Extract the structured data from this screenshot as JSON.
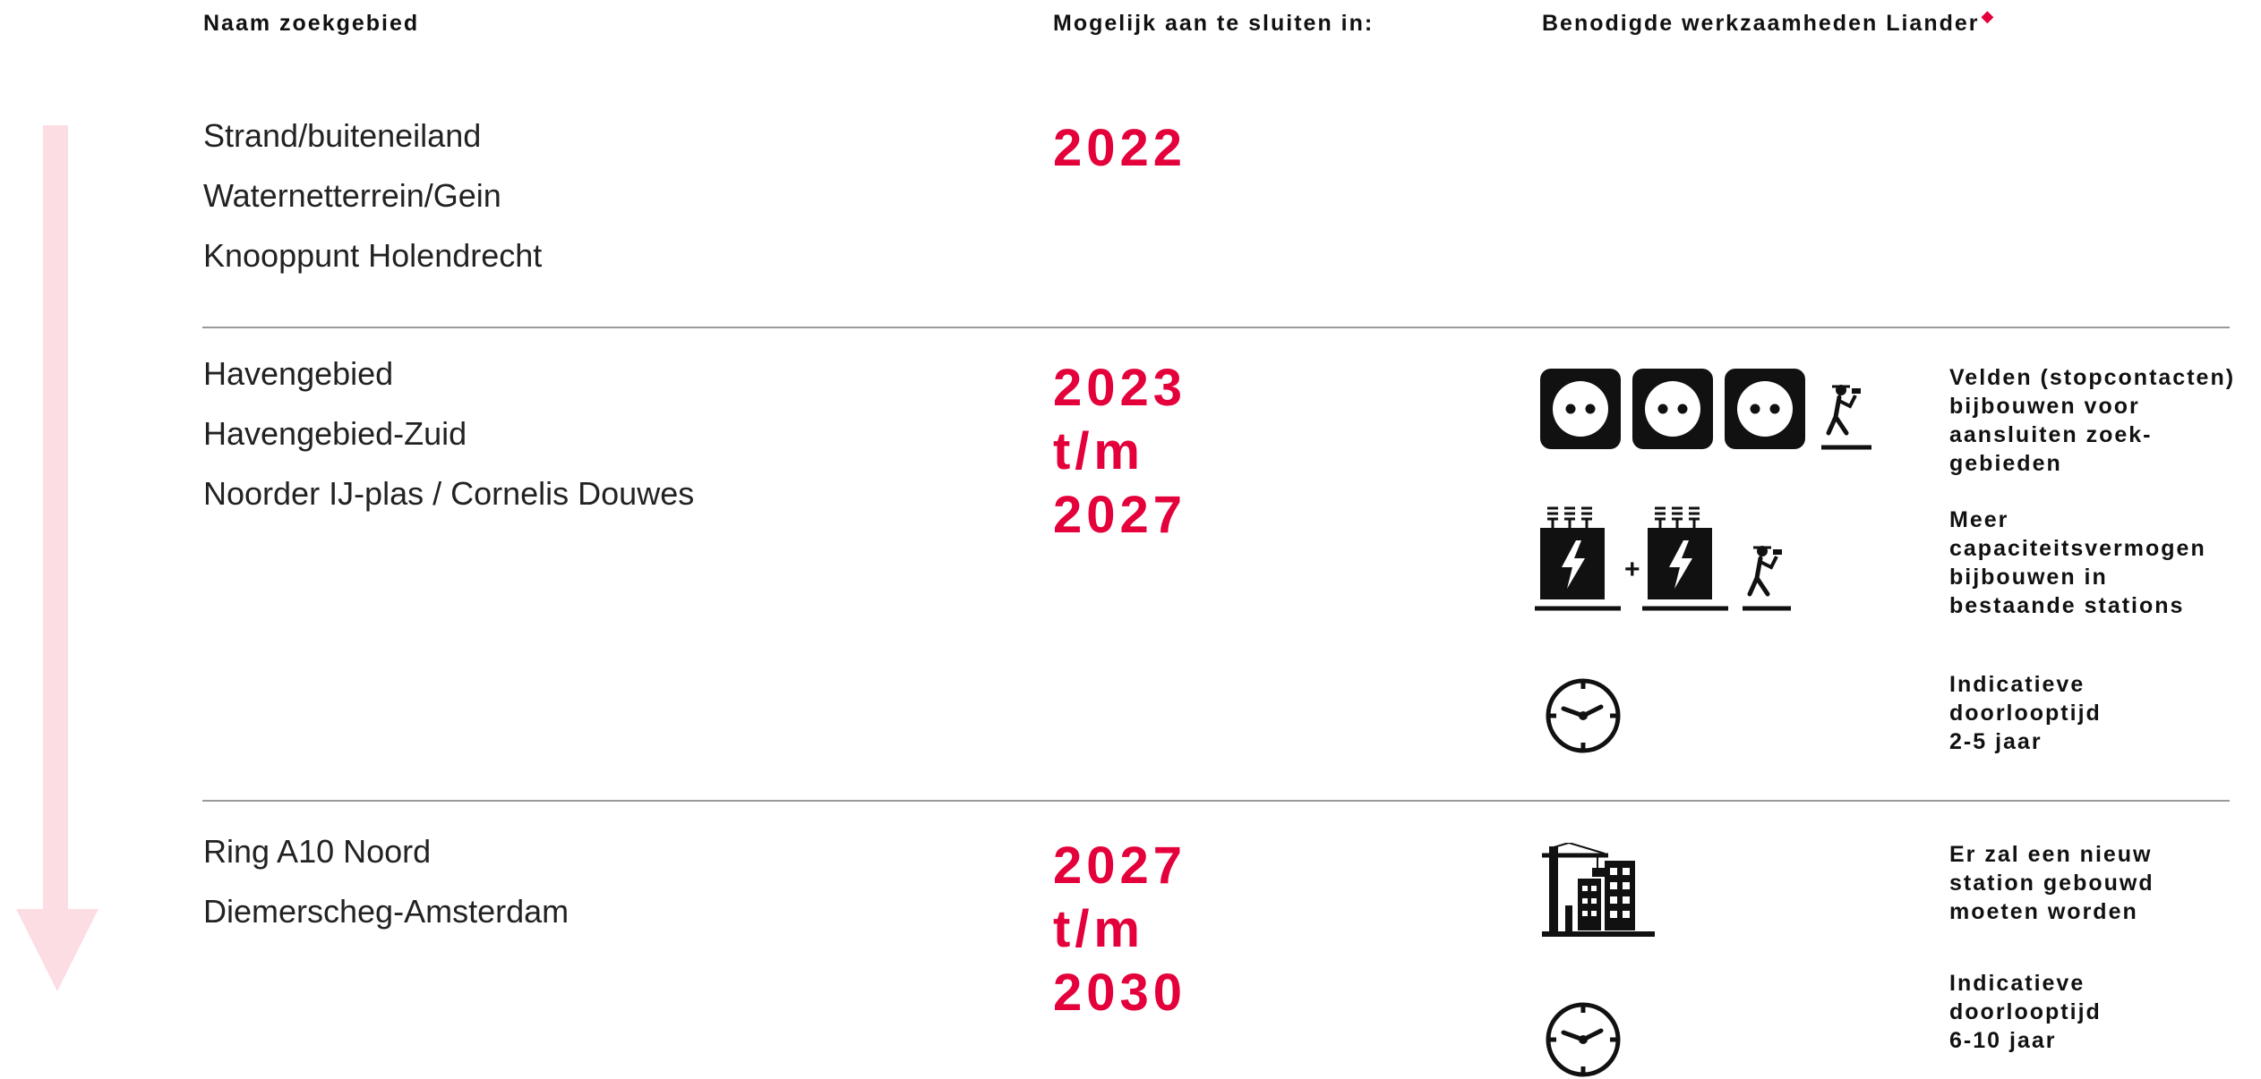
{
  "header": {
    "col_name": "Naam zoekgebied",
    "col_year": "Mogelijk aan te sluiten in:",
    "col_work": "Benodigde werkzaamheden Liander",
    "diamond": "◆"
  },
  "colors": {
    "accent": "#e4003a",
    "arrow": "#fddde4",
    "rule": "#9a9a9a",
    "icon": "#111111"
  },
  "groups": [
    {
      "names": [
        "Strand/buiteneiland",
        "Waternetterrein/Gein",
        "Knooppunt Holendrecht"
      ],
      "year": [
        "2022"
      ]
    },
    {
      "names": [
        "Havengebied",
        "Havengebied-Zuid",
        "Noorder IJ-plas / Cornelis Douwes"
      ],
      "year": [
        "2023",
        "t/m",
        "2027"
      ],
      "work": [
        {
          "icon": "socket-icons-worker",
          "lines": [
            "Velden (stopcontacten)",
            "bijbouwen voor",
            "aansluiten zoek-",
            "gebieden"
          ]
        },
        {
          "icon": "transformer-icons-worker",
          "plus": "+",
          "lines": [
            "Meer",
            "capaciteitsvermogen",
            "bijbouwen in",
            "bestaande stations"
          ]
        },
        {
          "icon": "clock-icon",
          "lines": [
            "Indicatieve",
            "doorlooptijd",
            "2-5 jaar"
          ]
        }
      ]
    },
    {
      "names": [
        "Ring A10 Noord",
        "Diemerscheg-Amsterdam"
      ],
      "year": [
        "2027",
        "t/m",
        "2030"
      ],
      "work": [
        {
          "icon": "construction-icon",
          "lines": [
            "Er zal een nieuw",
            "station gebouwd",
            "moeten worden"
          ]
        },
        {
          "icon": "clock-icon",
          "lines": [
            "Indicatieve",
            "doorlooptijd",
            "6-10 jaar"
          ]
        }
      ]
    }
  ]
}
